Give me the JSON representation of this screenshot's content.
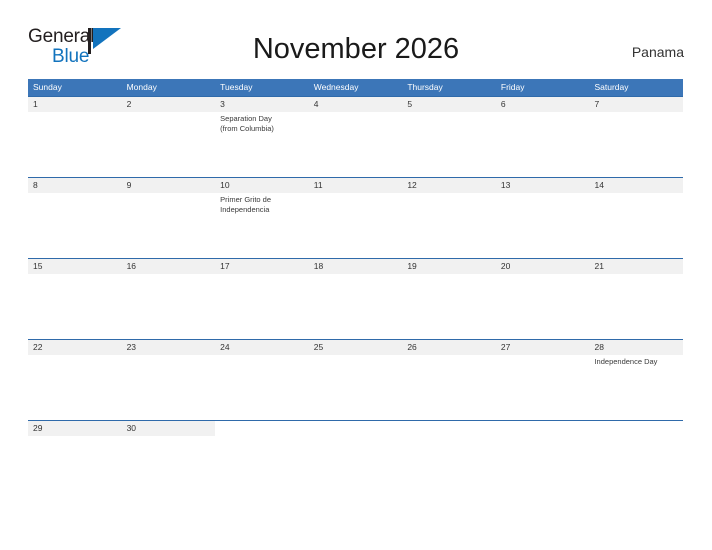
{
  "header": {
    "logo": {
      "word_one": "General",
      "word_two": "Blue",
      "mark_color": "#1273bd"
    },
    "title": "November 2026",
    "country": "Panama"
  },
  "calendar": {
    "accent_color": "#3c76b8",
    "band_color": "#f1f1f1",
    "weekdays": [
      "Sunday",
      "Monday",
      "Tuesday",
      "Wednesday",
      "Thursday",
      "Friday",
      "Saturday"
    ],
    "weeks": [
      {
        "days": [
          {
            "number": "1",
            "event": ""
          },
          {
            "number": "2",
            "event": ""
          },
          {
            "number": "3",
            "event": "Separation Day\n(from Columbia)"
          },
          {
            "number": "4",
            "event": ""
          },
          {
            "number": "5",
            "event": ""
          },
          {
            "number": "6",
            "event": ""
          },
          {
            "number": "7",
            "event": ""
          }
        ]
      },
      {
        "days": [
          {
            "number": "8",
            "event": ""
          },
          {
            "number": "9",
            "event": ""
          },
          {
            "number": "10",
            "event": "Primer Grito de\nIndependencia"
          },
          {
            "number": "11",
            "event": ""
          },
          {
            "number": "12",
            "event": ""
          },
          {
            "number": "13",
            "event": ""
          },
          {
            "number": "14",
            "event": ""
          }
        ]
      },
      {
        "days": [
          {
            "number": "15",
            "event": ""
          },
          {
            "number": "16",
            "event": ""
          },
          {
            "number": "17",
            "event": ""
          },
          {
            "number": "18",
            "event": ""
          },
          {
            "number": "19",
            "event": ""
          },
          {
            "number": "20",
            "event": ""
          },
          {
            "number": "21",
            "event": ""
          }
        ]
      },
      {
        "days": [
          {
            "number": "22",
            "event": ""
          },
          {
            "number": "23",
            "event": ""
          },
          {
            "number": "24",
            "event": ""
          },
          {
            "number": "25",
            "event": ""
          },
          {
            "number": "26",
            "event": ""
          },
          {
            "number": "27",
            "event": ""
          },
          {
            "number": "28",
            "event": "Independence Day"
          }
        ]
      },
      {
        "days": [
          {
            "number": "29",
            "event": ""
          },
          {
            "number": "30",
            "event": ""
          },
          {
            "number": "",
            "event": ""
          },
          {
            "number": "",
            "event": ""
          },
          {
            "number": "",
            "event": ""
          },
          {
            "number": "",
            "event": ""
          },
          {
            "number": "",
            "event": ""
          }
        ]
      }
    ]
  }
}
